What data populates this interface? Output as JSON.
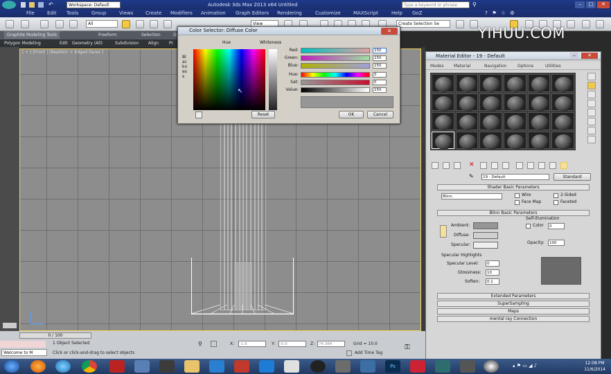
{
  "app": {
    "title": "Autodesk 3ds Max 2013 x64    Untitled",
    "workspace": "Workspace: Default",
    "search_placeholder": "Type a keyword or phrase"
  },
  "menu": [
    "File",
    "Edit",
    "Tools",
    "Group",
    "Views",
    "Create",
    "Modifiers",
    "Animation",
    "Graph Editors",
    "Rendering",
    "Customize",
    "MAXScript",
    "Help",
    "GoZ"
  ],
  "toolbar": {
    "filter": "All",
    "viewref": "View",
    "selection_set": "Create Selection Se"
  },
  "ribbon": {
    "tabs": [
      "Graphite Modeling Tools",
      "Freeform",
      "Selection",
      "O"
    ],
    "sub": [
      "Polygon Modeling",
      "Edit",
      "Geometry (All)",
      "Subdivision",
      "Align",
      "Pr"
    ]
  },
  "viewport": {
    "label": "[ + ] [Front ] [Realistic + Edged Faces ]"
  },
  "color_dialog": {
    "title": "Color Selector: Diffuse Color",
    "hue_label": "Hue",
    "whiteness_label": "Whiteness",
    "blackness_label": "Blackness",
    "sliders": [
      {
        "label": "Red:",
        "value": "150"
      },
      {
        "label": "Green:",
        "value": "150"
      },
      {
        "label": "Blue:",
        "value": "150"
      },
      {
        "label": "Hue:",
        "value": "0"
      },
      {
        "label": "Sat:",
        "value": "0"
      },
      {
        "label": "Value:",
        "value": "150"
      }
    ],
    "reset": "Reset",
    "ok": "OK",
    "cancel": "Cancel"
  },
  "material_editor": {
    "title": "Material Editor - 19 - Default",
    "menu": [
      "Modes",
      "Material",
      "Navigation",
      "Options",
      "Utilities"
    ],
    "material_name": "19 - Default",
    "material_type": "Standard",
    "rollouts": {
      "shader_basic": "Shader Basic Parameters",
      "blinn_basic": "Blinn Basic Parameters",
      "extended": "Extended Parameters",
      "supersampling": "SuperSampling",
      "maps": "Maps",
      "mental_ray": "mental ray Connection"
    },
    "shader": "Blinn",
    "checks": {
      "wire": "Wire",
      "two_sided": "2-Sided",
      "face_map": "Face Map",
      "faceted": "Faceted"
    },
    "self_illum": {
      "title": "Self-Illumination",
      "color_label": "Color",
      "value": "0"
    },
    "ambient": "Ambient:",
    "diffuse": "Diffuse:",
    "specular": "Specular:",
    "opacity_label": "Opacity:",
    "opacity": "100",
    "spec_highlights": "Specular Highlights",
    "spec_level_label": "Specular Level:",
    "spec_level": "0",
    "glossiness_label": "Glossiness:",
    "glossiness": "10",
    "soften_label": "Soften:",
    "soften": "0.1"
  },
  "status": {
    "timeline": "0 / 100",
    "selected": "1 Object Selected",
    "prompt": "Click or click-and-drag to select objects",
    "x_label": "X:",
    "x": "-1.6",
    "y_label": "Y:",
    "y": "-0.0",
    "z_label": "Z:",
    "z": "74.384",
    "grid": "Grid = 10.0",
    "add_time_tag": "Add Time Tag",
    "welcome": "Welcome to M"
  },
  "taskbar": {
    "time": "12:08 PM",
    "date": "11/6/2014"
  },
  "watermark": "YIHUU.COM",
  "colors": {
    "titlebar": "#1e3a8a",
    "viewport": "#8d8d8d",
    "selected_tool": "#f3c844"
  }
}
